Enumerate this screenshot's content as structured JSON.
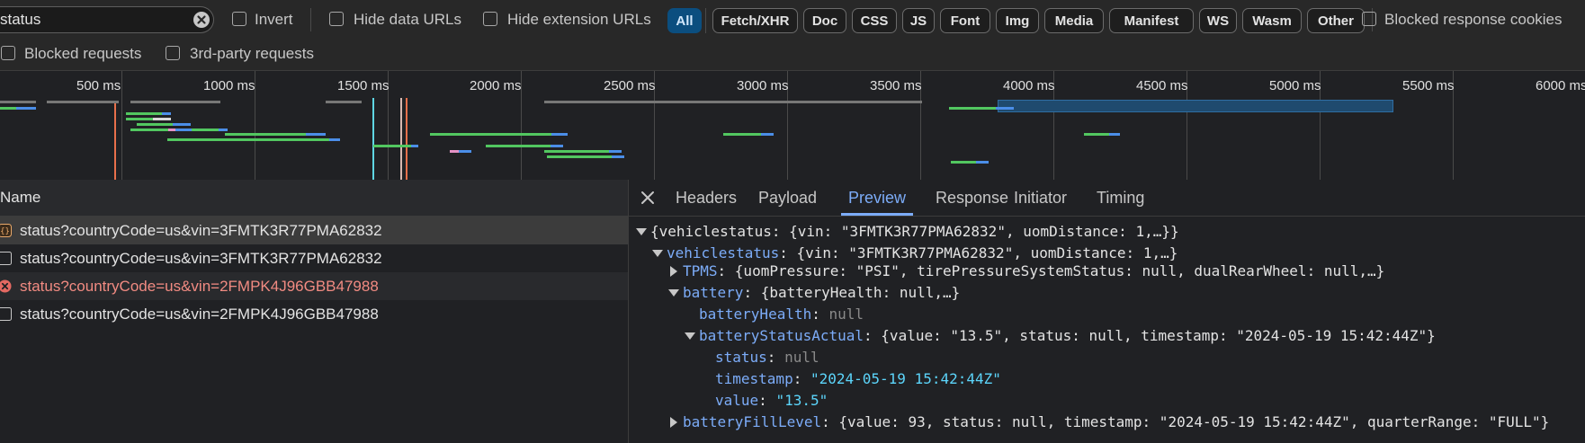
{
  "toolbar": {
    "filter_value": "status",
    "invert_label": "Invert",
    "hide_data_urls_label": "Hide data URLs",
    "hide_extension_urls_label": "Hide extension URLs",
    "type_filters": [
      "All",
      "Fetch/XHR",
      "Doc",
      "CSS",
      "JS",
      "Font",
      "Img",
      "Media",
      "Manifest",
      "WS",
      "Wasm",
      "Other"
    ],
    "active_type_filter": "All",
    "blocked_cookies_label": "Blocked response cookies",
    "blocked_requests_label": "Blocked requests",
    "third_party_label": "3rd-party requests"
  },
  "overview": {
    "ticks": [
      "500 ms",
      "1000 ms",
      "1500 ms",
      "2000 ms",
      "2500 ms",
      "3000 ms",
      "3500 ms",
      "4000 ms",
      "4500 ms",
      "5000 ms",
      "5500 ms",
      "6000 ms"
    ]
  },
  "requests": {
    "header": "Name",
    "rows": [
      {
        "name": "status?countryCode=us&vin=3FMTK3R77PMA62832",
        "icon": "xhr-icon",
        "state": "selected"
      },
      {
        "name": "status?countryCode=us&vin=3FMTK3R77PMA62832",
        "icon": "document-icon",
        "state": "normal"
      },
      {
        "name": "status?countryCode=us&vin=2FMPK4J96GBB47988",
        "icon": "error-icon",
        "state": "error"
      },
      {
        "name": "status?countryCode=us&vin=2FMPK4J96GBB47988",
        "icon": "document-icon",
        "state": "normal"
      }
    ]
  },
  "detail": {
    "close_icon": "close-icon",
    "tabs": [
      "Headers",
      "Payload",
      "Preview",
      "Response",
      "Initiator",
      "Timing"
    ],
    "active_tab": "Preview",
    "tree": {
      "root_summary": "{vehiclestatus: {vin: \"3FMTK3R77PMA62832\", uomDistance: 1,…}}",
      "vs_key": "vehiclestatus",
      "vs_summary": ": {vin: \"3FMTK3R77PMA62832\", uomDistance: 1,…}",
      "tpms_key": "TPMS",
      "tpms_summary": ": {uomPressure: \"PSI\", tirePressureSystemStatus: null, dualRearWheel: null,…}",
      "battery_key": "battery",
      "battery_summary": ": {batteryHealth: null,…}",
      "bh_key": "batteryHealth",
      "bh_value": "null",
      "bsa_key": "batteryStatusActual",
      "bsa_summary": ": {value: \"13.5\", status: null, timestamp: \"2024-05-19 15:42:44Z\"}",
      "status_key": "status",
      "status_value": "null",
      "timestamp_key": "timestamp",
      "timestamp_value": "\"2024-05-19 15:42:44Z\"",
      "value_key": "value",
      "value_value": "\"13.5\"",
      "bfl_key": "batteryFillLevel",
      "bfl_summary": ": {value: 93, status: null, timestamp: \"2024-05-19 15:42:44Z\", quarterRange: \"FULL\"}"
    }
  },
  "colors": {
    "background": "#202124",
    "accent": "#7cacf8",
    "active_chip": "#0b4e7f",
    "error_text": "#f28b82",
    "string_value": "#5cd5fb"
  }
}
